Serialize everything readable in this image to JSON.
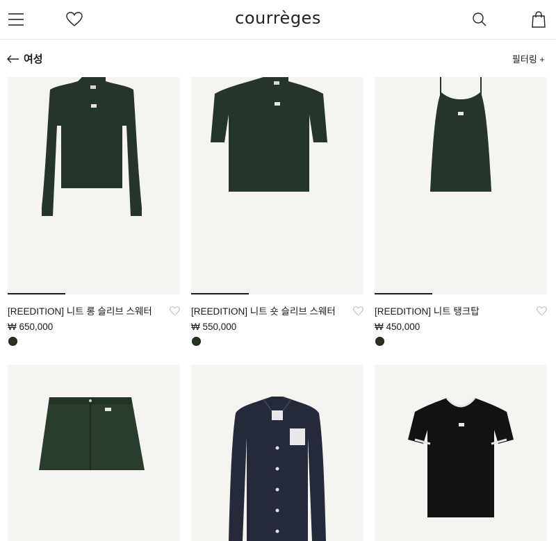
{
  "header": {
    "brand": "courrèges",
    "icons": [
      "menu-icon",
      "heart-icon",
      "search-icon",
      "bag-icon"
    ]
  },
  "subbar": {
    "back_label": "여성",
    "filter_label": "필터링 +"
  },
  "colors": {
    "image_bg": "#f5f4f0",
    "dark_green": "#26352b",
    "swatch_green": "#24331f"
  },
  "products": [
    {
      "name": "[REEDITION] 니트 롱 슬리브 스웨터",
      "price": "₩ 650,000",
      "swatch": "dark green"
    },
    {
      "name": "[REEDITION] 니트 숏 슬리브 스웨터",
      "price": "₩ 550,000",
      "swatch": "dark green"
    },
    {
      "name": "[REEDITION] 니트 탱크탑",
      "price": "₩ 450,000",
      "swatch": "dark green"
    },
    {
      "name": "",
      "price": "",
      "image": "green mini skirt"
    },
    {
      "name": "",
      "price": "",
      "image": "navy vinyl jacket"
    },
    {
      "name": "",
      "price": "",
      "image": "black t-shirt with white trim"
    }
  ]
}
